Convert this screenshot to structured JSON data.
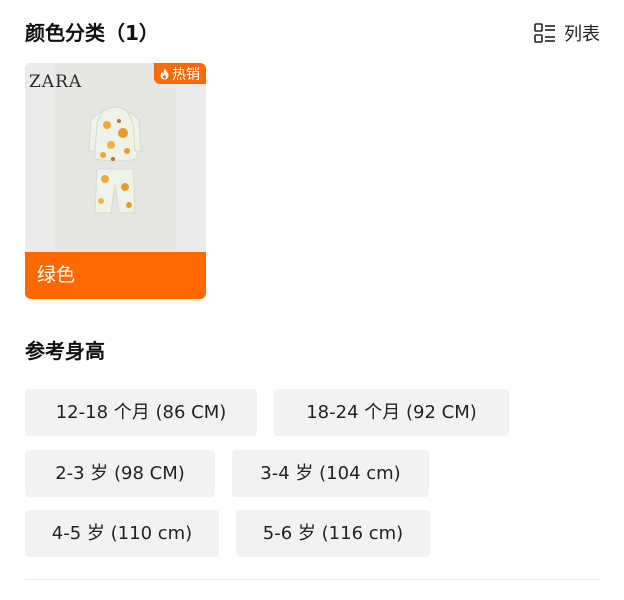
{
  "colors_section": {
    "title": "颜色分类（1）",
    "view_toggle_label": "列表",
    "view_toggle_icon": "list-view-icon"
  },
  "color_options": [
    {
      "label": "绿色",
      "badge": "热销",
      "badge_icon": "flame-icon",
      "brand": "ZARA",
      "selected": true
    }
  ],
  "height_section": {
    "title": "参考身高",
    "sizes": [
      "12-18 个月 (86 CM)",
      "18-24 个月 (92 CM)",
      "2-3 岁 (98 CM)",
      "3-4 岁 (104 cm)",
      "4-5 岁 (110 cm)",
      "5-6 岁 (116 cm)"
    ]
  },
  "colors": {
    "accent": "#ff6a00",
    "chip_background": "#f2f2f2"
  }
}
